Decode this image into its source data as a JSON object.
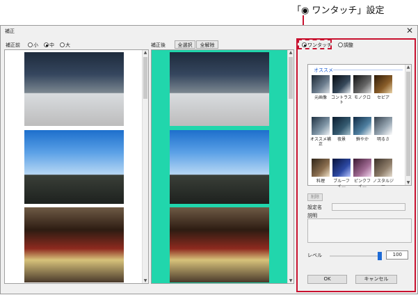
{
  "annotation": {
    "text": "「◉ ワンタッチ」設定",
    "color": "#c8102e"
  },
  "window": {
    "title": "補正",
    "close_glyph": "✕"
  },
  "before": {
    "label": "補正前",
    "size_options": [
      {
        "label": "小",
        "selected": false
      },
      {
        "label": "中",
        "selected": true
      },
      {
        "label": "大",
        "selected": false
      }
    ]
  },
  "after": {
    "label": "補正後",
    "select_all_label": "全選択",
    "deselect_all_label": "全解除",
    "highlight_color": "#21d6ac"
  },
  "mode": {
    "one_touch_label": "ワンタッチ",
    "adjust_label": "調整",
    "selected": "one_touch"
  },
  "recommend": {
    "group_title": "オススメ",
    "presets": [
      {
        "label": "元画像"
      },
      {
        "label": "コントラスト"
      },
      {
        "label": "モノクロ"
      },
      {
        "label": "セピア"
      },
      {
        "label": "オススメ補正"
      },
      {
        "label": "夜景"
      },
      {
        "label": "鮮やか"
      },
      {
        "label": "明るさ"
      },
      {
        "label": "料理"
      },
      {
        "label": "ブルーフィ..."
      },
      {
        "label": "ピンクフィ..."
      },
      {
        "label": "ノスタルジー"
      }
    ]
  },
  "preset_delete_label": "削除",
  "setting_name_label": "設定名",
  "description_label": "説明",
  "level": {
    "label": "レベル",
    "value": "100"
  },
  "buttons": {
    "ok": "OK",
    "cancel": "キャンセル"
  }
}
